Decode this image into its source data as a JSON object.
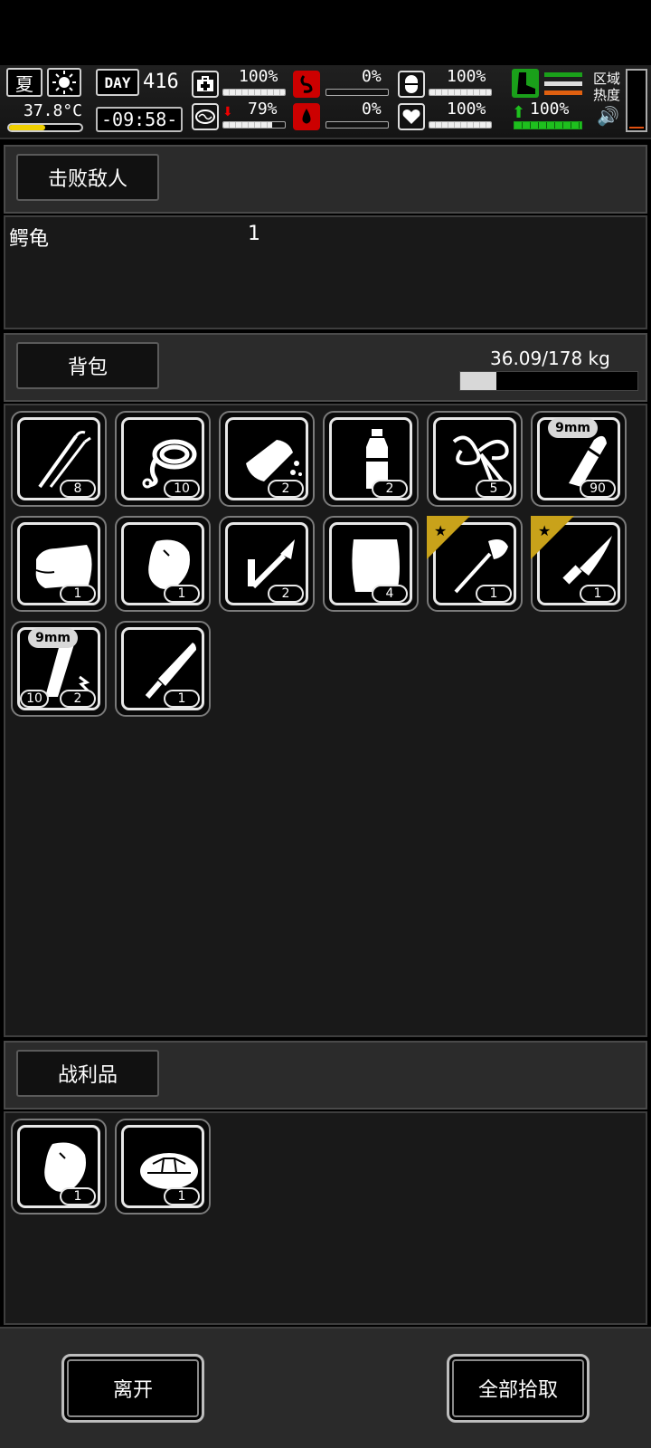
{
  "hud": {
    "season": "夏",
    "temperature": "37.8°C",
    "day_label": "DAY",
    "day_number": "416",
    "clock": "-09:58-",
    "stats": [
      {
        "icon": "medkit-icon",
        "value": "100%",
        "fill": 1.0
      },
      {
        "icon": "stomach-icon",
        "value": "0%",
        "fill": 0.0
      },
      {
        "icon": "pill-icon",
        "value": "100%",
        "fill": 1.0
      },
      {
        "icon": "brain-icon",
        "value": "79%",
        "fill": 0.79
      },
      {
        "icon": "blood-drop-icon",
        "value": "0%",
        "fill": 0.0
      },
      {
        "icon": "heart-icon",
        "value": "100%",
        "fill": 1.0
      }
    ],
    "stamina": "100%",
    "zone_heat_label": "区域\n热度"
  },
  "enemies": {
    "title": "击败敌人",
    "rows": [
      {
        "name": "鳄龟",
        "count": "1"
      }
    ]
  },
  "backpack": {
    "title": "背包",
    "weight": "36.09/178 kg",
    "weight_fraction": 0.2027,
    "items": [
      {
        "name": "lockpick-icon",
        "count": "8"
      },
      {
        "name": "rope-icon",
        "count": "10"
      },
      {
        "name": "bread-icon",
        "count": "2"
      },
      {
        "name": "water-bottle-icon",
        "count": "2"
      },
      {
        "name": "string-icon",
        "count": "5"
      },
      {
        "name": "bullet-icon",
        "count": "90",
        "tag": "9mm"
      },
      {
        "name": "cloth-icon",
        "count": "1"
      },
      {
        "name": "raw-meat-icon",
        "count": "1"
      },
      {
        "name": "soldering-iron-icon",
        "count": "2"
      },
      {
        "name": "towel-icon",
        "count": "4"
      },
      {
        "name": "shovel-icon",
        "count": "1",
        "star": true
      },
      {
        "name": "knife-icon",
        "count": "1",
        "star": true
      },
      {
        "name": "magazine-icon",
        "count": "2",
        "tag": "9mm",
        "left_count": "10"
      },
      {
        "name": "machete-icon",
        "count": "1"
      }
    ]
  },
  "loot": {
    "title": "战利品",
    "items": [
      {
        "name": "raw-meat-icon",
        "count": "1"
      },
      {
        "name": "turtle-shell-icon",
        "count": "1"
      }
    ]
  },
  "buttons": {
    "leave": "离开",
    "pick_all": "全部拾取"
  }
}
